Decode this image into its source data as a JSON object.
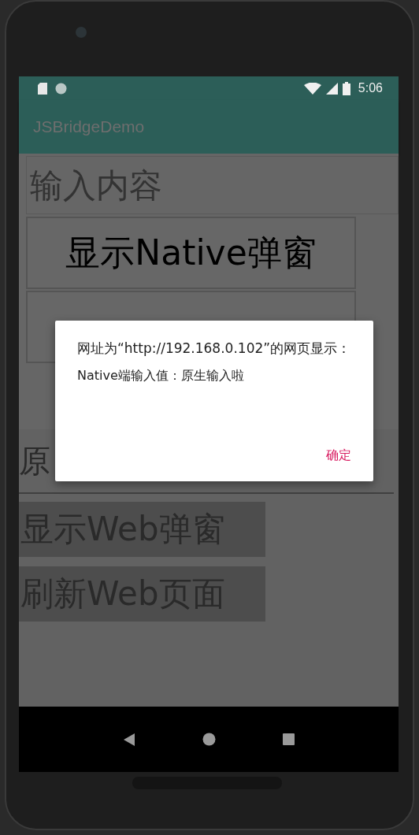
{
  "status_bar": {
    "time": "5:06"
  },
  "app_bar": {
    "title": "JSBridgeDemo"
  },
  "native": {
    "input": {
      "placeholder": "输入内容"
    },
    "buttons": [
      "显示Native弹窗"
    ]
  },
  "web": {
    "input": {
      "value": "原"
    },
    "buttons": [
      "显示Web弹窗",
      "刷新Web页面"
    ]
  },
  "dialog": {
    "title": "网址为“http://192.168.0.102”的网页显示：",
    "message": "Native端输入值：原生输入啦",
    "button": "确定"
  }
}
